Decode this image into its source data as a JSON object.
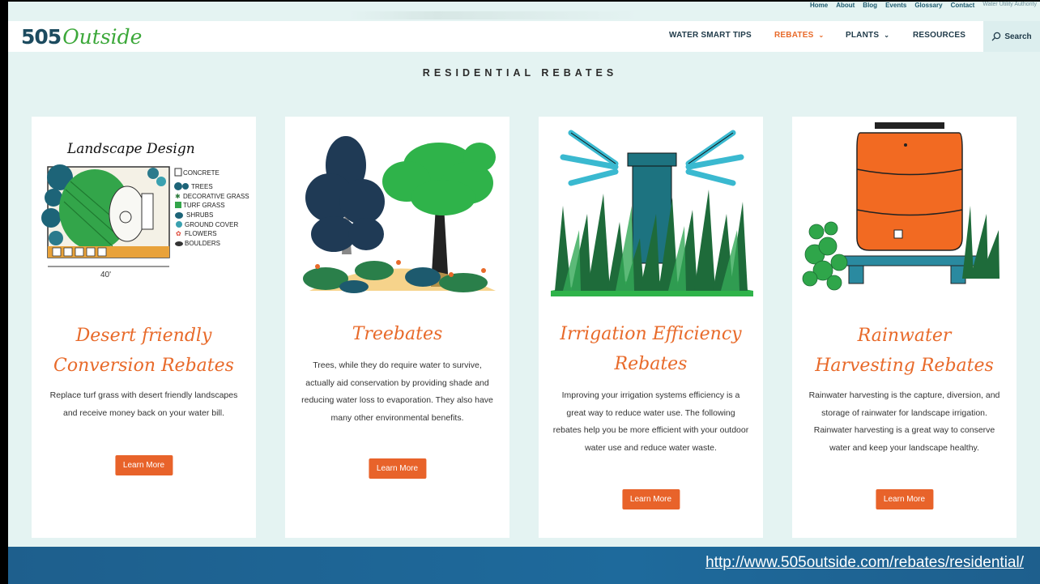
{
  "utility_links": [
    "Home",
    "About",
    "Blog",
    "Events",
    "Glossary",
    "Contact"
  ],
  "utility_org": "Water Utility Authority",
  "logo": {
    "num": "505",
    "word": "Outside"
  },
  "nav": [
    {
      "label": "WATER SMART TIPS"
    },
    {
      "label": "REBATES",
      "active": true
    },
    {
      "label": "PLANTS"
    },
    {
      "label": "RESOURCES"
    }
  ],
  "search_label": "Search",
  "heading": "RESIDENTIAL REBATES",
  "cards": [
    {
      "title_line1": "Desert friendly",
      "title_line2": "Conversion Rebates",
      "text": "Replace turf grass with desert friendly landscapes and receive money back on your water bill.",
      "button": "Learn More",
      "illustration": {
        "title": "Landscape Design",
        "legend": [
          "CONCRETE",
          "TREES",
          "DECORATIVE GRASS",
          "TURF GRASS",
          "SHRUBS",
          "GROUND COVER",
          "FLOWERS",
          "BOULDERS"
        ],
        "dimension": "40'"
      }
    },
    {
      "title_line1": "Treebates",
      "title_line2": "",
      "text": "Trees, while they do require water to survive, actually aid conservation by providing shade and reducing water loss to evaporation. They also have many other environmental benefits.",
      "button": "Learn More"
    },
    {
      "title_line1": "Irrigation Efficiency",
      "title_line2": "Rebates",
      "text": "Improving your irrigation systems efficiency is a great way to reduce water use.  The following rebates help you be more efficient with your outdoor water use and reduce water waste.",
      "button": "Learn More"
    },
    {
      "title_line1": "Rainwater",
      "title_line2": "Harvesting Rebates",
      "text": "Rainwater harvesting is the capture, diversion, and storage of rainwater for landscape irrigation. Rainwater harvesting is a great way to conserve water and keep your landscape healthy.",
      "button": "Learn More"
    }
  ],
  "footer_url": "http://www.505outside.com/rebates/residential/",
  "colors": {
    "accent": "#e86a2a",
    "background": "#e4f3f2",
    "footer": "#1e659a",
    "logo_green": "#3ca83a",
    "navy": "#1c4b5f"
  }
}
